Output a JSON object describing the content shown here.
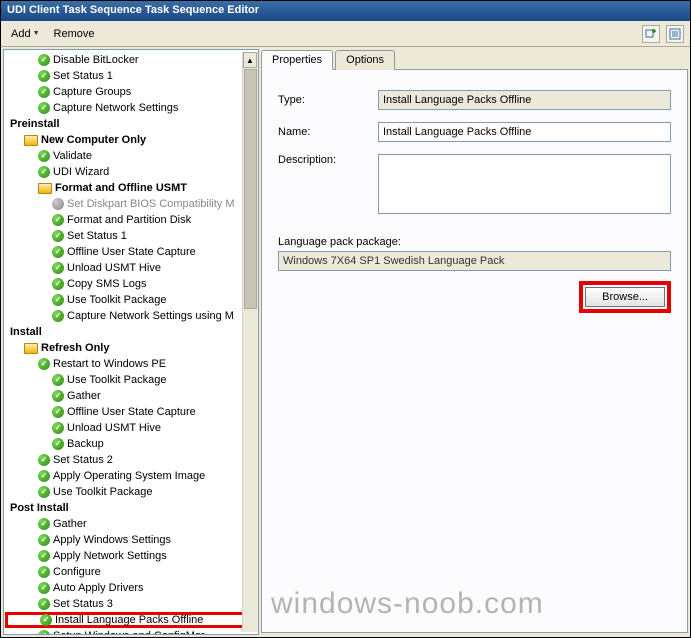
{
  "window": {
    "title": "UDI Client Task Sequence Task Sequence Editor"
  },
  "toolbar": {
    "add": "Add",
    "remove": "Remove"
  },
  "tree": {
    "items": [
      {
        "kind": "item",
        "indent": 2,
        "icon": "check",
        "label": "Disable BitLocker"
      },
      {
        "kind": "item",
        "indent": 2,
        "icon": "check",
        "label": "Set Status 1"
      },
      {
        "kind": "item",
        "indent": 2,
        "icon": "check",
        "label": "Capture Groups"
      },
      {
        "kind": "item",
        "indent": 2,
        "icon": "check",
        "label": "Capture Network Settings"
      },
      {
        "kind": "header",
        "indent": 0,
        "label": "Preinstall"
      },
      {
        "kind": "subheader",
        "indent": 1,
        "icon": "folder",
        "label": "New Computer Only"
      },
      {
        "kind": "item",
        "indent": 2,
        "icon": "check",
        "label": "Validate"
      },
      {
        "kind": "item",
        "indent": 2,
        "icon": "check",
        "label": "UDI Wizard"
      },
      {
        "kind": "subheader",
        "indent": 2,
        "icon": "folder",
        "label": "Format and Offline USMT"
      },
      {
        "kind": "item",
        "indent": 3,
        "icon": "gear",
        "label": "Set Diskpart BIOS Compatibility M",
        "disabled": true
      },
      {
        "kind": "item",
        "indent": 3,
        "icon": "check",
        "label": "Format and Partition Disk"
      },
      {
        "kind": "item",
        "indent": 3,
        "icon": "check",
        "label": "Set Status 1"
      },
      {
        "kind": "item",
        "indent": 3,
        "icon": "check",
        "label": "Offline User State Capture"
      },
      {
        "kind": "item",
        "indent": 3,
        "icon": "check",
        "label": "Unload USMT Hive"
      },
      {
        "kind": "item",
        "indent": 3,
        "icon": "check",
        "label": "Copy SMS Logs"
      },
      {
        "kind": "item",
        "indent": 3,
        "icon": "check",
        "label": "Use Toolkit Package"
      },
      {
        "kind": "item",
        "indent": 3,
        "icon": "check",
        "label": "Capture Network Settings using M"
      },
      {
        "kind": "header",
        "indent": 0,
        "label": "Install"
      },
      {
        "kind": "subheader",
        "indent": 1,
        "icon": "folder",
        "label": "Refresh Only"
      },
      {
        "kind": "item",
        "indent": 2,
        "icon": "check",
        "label": "Restart to Windows PE"
      },
      {
        "kind": "item",
        "indent": 3,
        "icon": "check",
        "label": "Use Toolkit Package"
      },
      {
        "kind": "item",
        "indent": 3,
        "icon": "check",
        "label": "Gather"
      },
      {
        "kind": "item",
        "indent": 3,
        "icon": "check",
        "label": "Offline User State Capture"
      },
      {
        "kind": "item",
        "indent": 3,
        "icon": "check",
        "label": "Unload USMT Hive"
      },
      {
        "kind": "item",
        "indent": 3,
        "icon": "check",
        "label": "Backup"
      },
      {
        "kind": "item",
        "indent": 2,
        "icon": "check",
        "label": "Set Status 2"
      },
      {
        "kind": "item",
        "indent": 2,
        "icon": "check",
        "label": "Apply Operating System Image"
      },
      {
        "kind": "item",
        "indent": 2,
        "icon": "check",
        "label": "Use Toolkit Package"
      },
      {
        "kind": "header",
        "indent": 0,
        "label": "Post Install"
      },
      {
        "kind": "item",
        "indent": 2,
        "icon": "check",
        "label": "Gather"
      },
      {
        "kind": "item",
        "indent": 2,
        "icon": "check",
        "label": "Apply Windows Settings"
      },
      {
        "kind": "item",
        "indent": 2,
        "icon": "check",
        "label": "Apply Network Settings"
      },
      {
        "kind": "item",
        "indent": 2,
        "icon": "check",
        "label": "Configure"
      },
      {
        "kind": "item",
        "indent": 2,
        "icon": "check",
        "label": "Auto Apply Drivers"
      },
      {
        "kind": "item",
        "indent": 2,
        "icon": "check",
        "label": "Set Status 3"
      },
      {
        "kind": "item",
        "indent": 2,
        "icon": "check",
        "label": "Install Language Packs Offline",
        "highlight": true
      },
      {
        "kind": "item",
        "indent": 2,
        "icon": "check",
        "label": "Setup Windows and ConfigMgr"
      }
    ]
  },
  "tabs": {
    "properties": "Properties",
    "options": "Options"
  },
  "form": {
    "type_label": "Type:",
    "type_value": "Install Language Packs Offline",
    "name_label": "Name:",
    "name_value": "Install Language Packs Offline",
    "desc_label": "Description:",
    "desc_value": "",
    "pkg_label": "Language pack package:",
    "pkg_value": "Windows 7X64 SP1 Swedish Language Pack",
    "browse": "Browse..."
  },
  "watermark": "windows-noob.com"
}
